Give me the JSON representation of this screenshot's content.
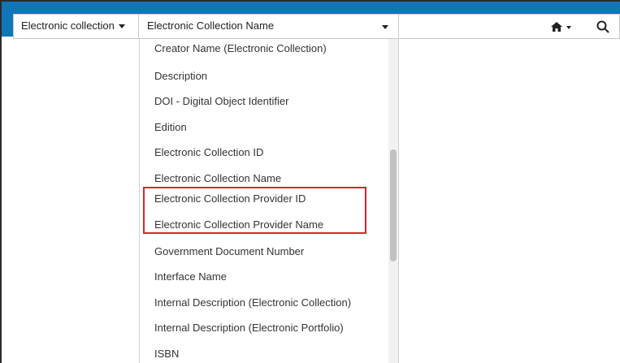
{
  "search_bar": {
    "scope_label": "Electronic collection",
    "field_label": "Electronic Collection Name"
  },
  "icons": {
    "home": "home-icon",
    "search": "search-icon"
  },
  "colors": {
    "topbar": "#1176b8",
    "highlight": "#d9252a"
  },
  "dropdown": {
    "options": [
      "Creator Name (Electronic Collection)",
      "Description",
      "DOI - Digital Object Identifier",
      "Edition",
      "Electronic Collection ID",
      "Electronic Collection Name",
      "Electronic Collection Provider ID",
      "Electronic Collection Provider Name",
      "Government Document Number",
      "Interface Name",
      "Internal Description (Electronic Collection)",
      "Internal Description (Electronic Portfolio)",
      "ISBN"
    ]
  }
}
